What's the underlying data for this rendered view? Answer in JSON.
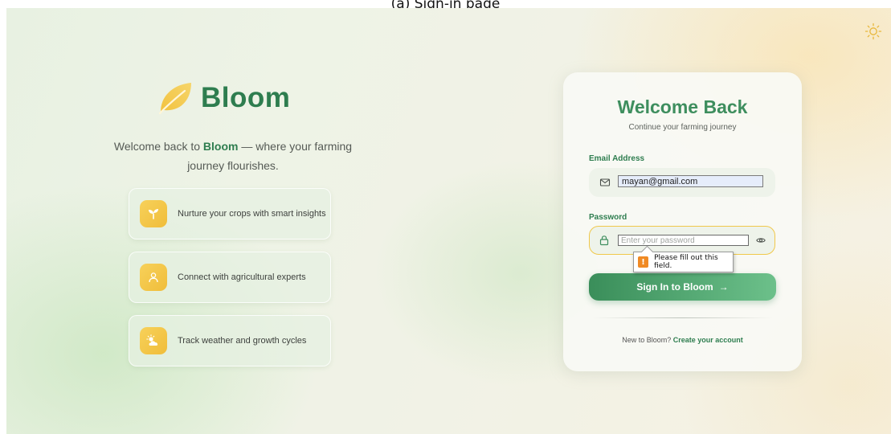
{
  "caption": "(a) Sign-in page",
  "brand": {
    "name": "Bloom"
  },
  "tagline": {
    "prefix": "Welcome back to ",
    "brand": "Bloom",
    "suffix": " — where your farming journey flourishes."
  },
  "features": [
    {
      "icon": "sprout-icon",
      "text": "Nurture your crops with smart insights"
    },
    {
      "icon": "user-icon",
      "text": "Connect with agricultural experts"
    },
    {
      "icon": "weather-icon",
      "text": "Track weather and growth cycles"
    }
  ],
  "card": {
    "title": "Welcome Back",
    "subtitle": "Continue your farming journey",
    "email_label": "Email Address",
    "email_value": "mayan@gmail.com",
    "password_label": "Password",
    "password_placeholder": "Enter your password",
    "validation_message": "Please fill out this field.",
    "signin_label": "Sign In to Bloom",
    "signin_arrow": "→",
    "footer_prefix": "New to Bloom? ",
    "footer_link": "Create your account"
  },
  "colors": {
    "brand_green": "#2e7d4f",
    "accent_yellow": "#f0bd3a",
    "warning_orange": "#f08a24"
  },
  "icons": [
    "sun-icon",
    "leaf-logo-icon",
    "mail-icon",
    "lock-icon",
    "eye-icon",
    "warning-icon"
  ]
}
